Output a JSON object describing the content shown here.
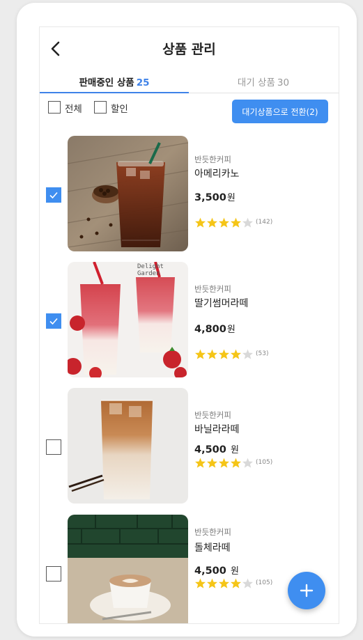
{
  "header": {
    "title": "상품 관리"
  },
  "tabs": [
    {
      "label": "판매중인 상품",
      "count": "25"
    },
    {
      "label": "대기 상품",
      "count": "30"
    }
  ],
  "filters": {
    "all_label": "전체",
    "discount_label": "할인",
    "switch_button": "대기상품으로 전환(2)"
  },
  "products": [
    {
      "brand": "반듯한커피",
      "name": "아메리카노",
      "price": "3,500",
      "currency": "원",
      "rating": 4,
      "reviews": "(142)",
      "checked": true
    },
    {
      "brand": "반듯한커피",
      "name": "딸기썸머라떼",
      "price": "4,800",
      "currency": "원",
      "rating": 4,
      "reviews": "(53)",
      "checked": true,
      "image_text": "Delight Garden"
    },
    {
      "brand": "반듯한커피",
      "name": "바닐라라떼",
      "price": "4,500",
      "currency": "원",
      "rating": 4,
      "reviews": "(105)",
      "checked": false
    },
    {
      "brand": "반듯한커피",
      "name": "돌체라떼",
      "price": "4,500",
      "currency": "원",
      "rating": 4,
      "reviews": "(105)",
      "checked": false
    }
  ],
  "colors": {
    "accent": "#3f8ef0",
    "star": "#f5c518",
    "star_empty": "#d9d9d9"
  },
  "icons": {
    "back": "chevron-left-icon",
    "add": "plus-icon",
    "check": "check-icon",
    "star": "star-icon"
  }
}
